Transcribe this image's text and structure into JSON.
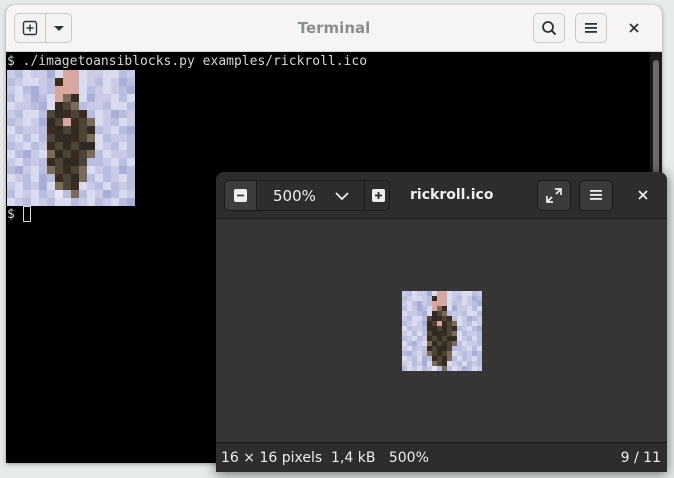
{
  "terminal": {
    "title": "Terminal",
    "command_line": "$ ./imagetoansiblocks.py examples/rickroll.ico",
    "prompt": "$ "
  },
  "viewer": {
    "zoom": "500%",
    "filename": "rickroll.ico",
    "status": {
      "dimensions": "16 × 16 pixels",
      "size": "1,4 kB",
      "zoom": "500%",
      "position": "9 / 11"
    }
  },
  "icons": {
    "new_tab": "new-tab-icon",
    "menu_down": "chevron-down-icon",
    "search": "search-icon",
    "hamburger": "hamburger-menu-icon",
    "close": "close-icon",
    "zoom_out": "minus-icon",
    "zoom_in": "plus-icon",
    "fullscreen": "fullscreen-icon"
  },
  "colors": {
    "desktop": "#e6ebea",
    "terminal_bg": "#000000",
    "viewer_bg": "#353535",
    "viewer_header": "#2d2d2d"
  }
}
